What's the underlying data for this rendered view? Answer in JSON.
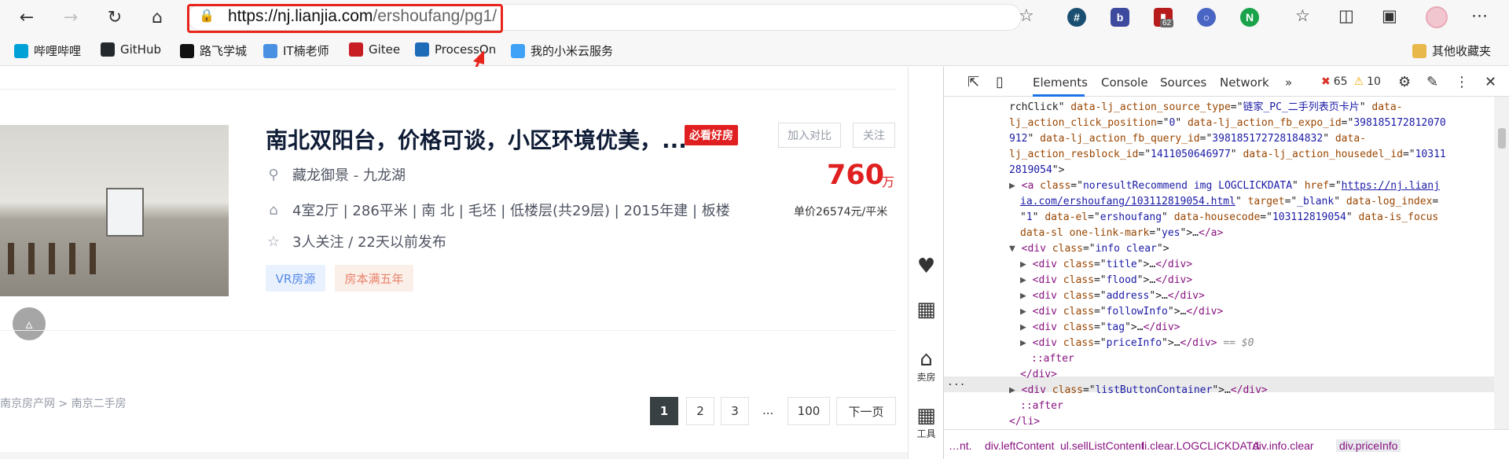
{
  "browser": {
    "url_domain": "https://nj.lianjia.com",
    "url_path": "/ershoufang/pg1/",
    "extension_badge": "62",
    "bookmarks": [
      {
        "label": "哔哩哔哩",
        "icon": "bilibili-icon",
        "color": "#00a1d6"
      },
      {
        "label": "GitHub",
        "icon": "github-icon",
        "color": "#24292e"
      },
      {
        "label": "路飞学城",
        "icon": "luffy-icon",
        "color": "#111111"
      },
      {
        "label": "IT楠老师",
        "icon": "it-icon",
        "color": "#4a90e2"
      },
      {
        "label": "Gitee",
        "icon": "gitee-icon",
        "color": "#c71d23"
      },
      {
        "label": "ProcessOn",
        "icon": "processon-icon",
        "color": "#1e6bb8"
      },
      {
        "label": "我的小米云服务",
        "icon": "mi-cloud-icon",
        "color": "#3fa2f7"
      }
    ],
    "other_bookmarks": "其他收藏夹",
    "annotation_color": "#e8251c"
  },
  "listing": {
    "title": "南北双阳台，价格可谈，小区环境优美，...",
    "must_see_badge": "必看好房",
    "compare_label": "加入对比",
    "follow_label": "关注",
    "location": "藏龙御景 - 九龙湖",
    "house_info": "4室2厅 | 286平米 | 南 北 | 毛坯 | 低楼层(共29层) | 2015年建 | 板楼",
    "follow_info": "3人关注 / 22天以前发布",
    "tags": [
      "VR房源",
      "房本满五年"
    ],
    "total_price": "760",
    "total_price_unit": "万",
    "unit_price": "单价26574元/平米"
  },
  "breadcrumb": "南京房产网 > 南京二手房",
  "pagination": {
    "pages": [
      "1",
      "2",
      "3"
    ],
    "ellipsis": "...",
    "last": "100",
    "next": "下一页",
    "active": "1"
  },
  "side_tools": {
    "sell_label": "卖房",
    "tools_label": "工具"
  },
  "devtools": {
    "tabs": [
      "Elements",
      "Console",
      "Sources",
      "Network"
    ],
    "active_tab": "Elements",
    "more_tabs": "»",
    "error_count": "65",
    "warning_count": "10",
    "code_lines": [
      {
        "indent": 0,
        "segments": [
          [
            "tx",
            "rchClick\" "
          ],
          [
            "an",
            "data-lj_action_source_type"
          ],
          [
            "tx",
            "=\""
          ],
          [
            "av",
            "链家_PC_二手列表页卡片"
          ],
          [
            "tx",
            "\" "
          ],
          [
            "an",
            "data-"
          ]
        ]
      },
      {
        "indent": 0,
        "segments": [
          [
            "an",
            "lj_action_click_position"
          ],
          [
            "tx",
            "=\""
          ],
          [
            "av",
            "0"
          ],
          [
            "tx",
            "\" "
          ],
          [
            "an",
            "data-lj_action_fb_expo_id"
          ],
          [
            "tx",
            "=\""
          ],
          [
            "av",
            "398185172812070"
          ]
        ]
      },
      {
        "indent": 0,
        "segments": [
          [
            "av",
            "912"
          ],
          [
            "tx",
            "\" "
          ],
          [
            "an",
            "data-lj_action_fb_query_id"
          ],
          [
            "tx",
            "=\""
          ],
          [
            "av",
            "398185172728184832"
          ],
          [
            "tx",
            "\" "
          ],
          [
            "an",
            "data-"
          ]
        ]
      },
      {
        "indent": 0,
        "segments": [
          [
            "an",
            "lj_action_resblock_id"
          ],
          [
            "tx",
            "=\""
          ],
          [
            "av",
            "1411050646977"
          ],
          [
            "tx",
            "\" "
          ],
          [
            "an",
            "data-lj_action_housedel_id"
          ],
          [
            "tx",
            "=\""
          ],
          [
            "av",
            "10311"
          ]
        ]
      },
      {
        "indent": 0,
        "segments": [
          [
            "av",
            "2819054"
          ],
          [
            "tx",
            "\">"
          ]
        ]
      },
      {
        "indent": 1,
        "tri": "▶",
        "segments": [
          [
            "tg",
            "<a "
          ],
          [
            "an",
            "class"
          ],
          [
            "tx",
            "=\""
          ],
          [
            "av",
            "noresultRecommend img LOGCLICKDATA"
          ],
          [
            "tx",
            "\" "
          ],
          [
            "an",
            "href"
          ],
          [
            "tx",
            "=\""
          ],
          [
            "lk",
            "https://nj.lianj"
          ]
        ]
      },
      {
        "indent": 1,
        "segments": [
          [
            "lk",
            "ia.com/ershoufang/103112819054.html"
          ],
          [
            "tx",
            "\" "
          ],
          [
            "an",
            "target"
          ],
          [
            "tx",
            "=\""
          ],
          [
            "av",
            "_blank"
          ],
          [
            "tx",
            "\" "
          ],
          [
            "an",
            "data-log_index"
          ],
          [
            "tx",
            "="
          ]
        ]
      },
      {
        "indent": 1,
        "segments": [
          [
            "tx",
            "\""
          ],
          [
            "av",
            "1"
          ],
          [
            "tx",
            "\" "
          ],
          [
            "an",
            "data-el"
          ],
          [
            "tx",
            "=\""
          ],
          [
            "av",
            "ershoufang"
          ],
          [
            "tx",
            "\" "
          ],
          [
            "an",
            "data-housecode"
          ],
          [
            "tx",
            "=\""
          ],
          [
            "av",
            "103112819054"
          ],
          [
            "tx",
            "\" "
          ],
          [
            "an",
            "data-is_focus"
          ]
        ]
      },
      {
        "indent": 1,
        "segments": [
          [
            "an",
            "data-sl"
          ],
          [
            "tx",
            " "
          ],
          [
            "an",
            "one-link-mark"
          ],
          [
            "tx",
            "=\""
          ],
          [
            "av",
            "yes"
          ],
          [
            "tx",
            "\">…"
          ],
          [
            "tg",
            "</a>"
          ]
        ]
      },
      {
        "indent": 1,
        "tri": "▼",
        "segments": [
          [
            "tg",
            "<div "
          ],
          [
            "an",
            "class"
          ],
          [
            "tx",
            "=\""
          ],
          [
            "av",
            "info clear"
          ],
          [
            "tx",
            "\">"
          ]
        ]
      },
      {
        "indent": 2,
        "tri": "▶",
        "segments": [
          [
            "tg",
            "<div "
          ],
          [
            "an",
            "class"
          ],
          [
            "tx",
            "=\""
          ],
          [
            "av",
            "title"
          ],
          [
            "tx",
            "\">…"
          ],
          [
            "tg",
            "</div>"
          ]
        ]
      },
      {
        "indent": 2,
        "tri": "▶",
        "segments": [
          [
            "tg",
            "<div "
          ],
          [
            "an",
            "class"
          ],
          [
            "tx",
            "=\""
          ],
          [
            "av",
            "flood"
          ],
          [
            "tx",
            "\">…"
          ],
          [
            "tg",
            "</div>"
          ]
        ]
      },
      {
        "indent": 2,
        "tri": "▶",
        "segments": [
          [
            "tg",
            "<div "
          ],
          [
            "an",
            "class"
          ],
          [
            "tx",
            "=\""
          ],
          [
            "av",
            "address"
          ],
          [
            "tx",
            "\">…"
          ],
          [
            "tg",
            "</div>"
          ]
        ]
      },
      {
        "indent": 2,
        "tri": "▶",
        "segments": [
          [
            "tg",
            "<div "
          ],
          [
            "an",
            "class"
          ],
          [
            "tx",
            "=\""
          ],
          [
            "av",
            "followInfo"
          ],
          [
            "tx",
            "\">…"
          ],
          [
            "tg",
            "</div>"
          ]
        ]
      },
      {
        "indent": 2,
        "tri": "▶",
        "segments": [
          [
            "tg",
            "<div "
          ],
          [
            "an",
            "class"
          ],
          [
            "tx",
            "=\""
          ],
          [
            "av",
            "tag"
          ],
          [
            "tx",
            "\">…"
          ],
          [
            "tg",
            "</div>"
          ]
        ]
      },
      {
        "indent": 2,
        "tri": "▶",
        "segments": [
          [
            "tg",
            "<div "
          ],
          [
            "an",
            "class"
          ],
          [
            "tx",
            "=\""
          ],
          [
            "av",
            "priceInfo"
          ],
          [
            "tx",
            "\">…"
          ],
          [
            "tg",
            "</div>"
          ],
          [
            "dim",
            " == $0"
          ]
        ]
      },
      {
        "indent": 2,
        "segments": [
          [
            "tg",
            "::after"
          ]
        ]
      },
      {
        "indent": 1,
        "segments": [
          [
            "tg",
            "</div>"
          ]
        ]
      },
      {
        "indent": 1,
        "tri": "▶",
        "segments": [
          [
            "tg",
            "<div "
          ],
          [
            "an",
            "class"
          ],
          [
            "tx",
            "=\""
          ],
          [
            "av",
            "listButtonContainer"
          ],
          [
            "tx",
            "\">…"
          ],
          [
            "tg",
            "</div>"
          ]
        ]
      },
      {
        "indent": 1,
        "segments": [
          [
            "tg",
            "::after"
          ]
        ]
      },
      {
        "indent": 0,
        "segments": [
          [
            "tg",
            "</li>"
          ]
        ]
      }
    ],
    "selected_row_marker": "...",
    "breadcrumbs": [
      "…nt.",
      "div.leftContent",
      "ul.sellListContent",
      "li.clear.LOGCLICKDATA",
      "div.info.clear",
      "div.priceInfo"
    ]
  }
}
